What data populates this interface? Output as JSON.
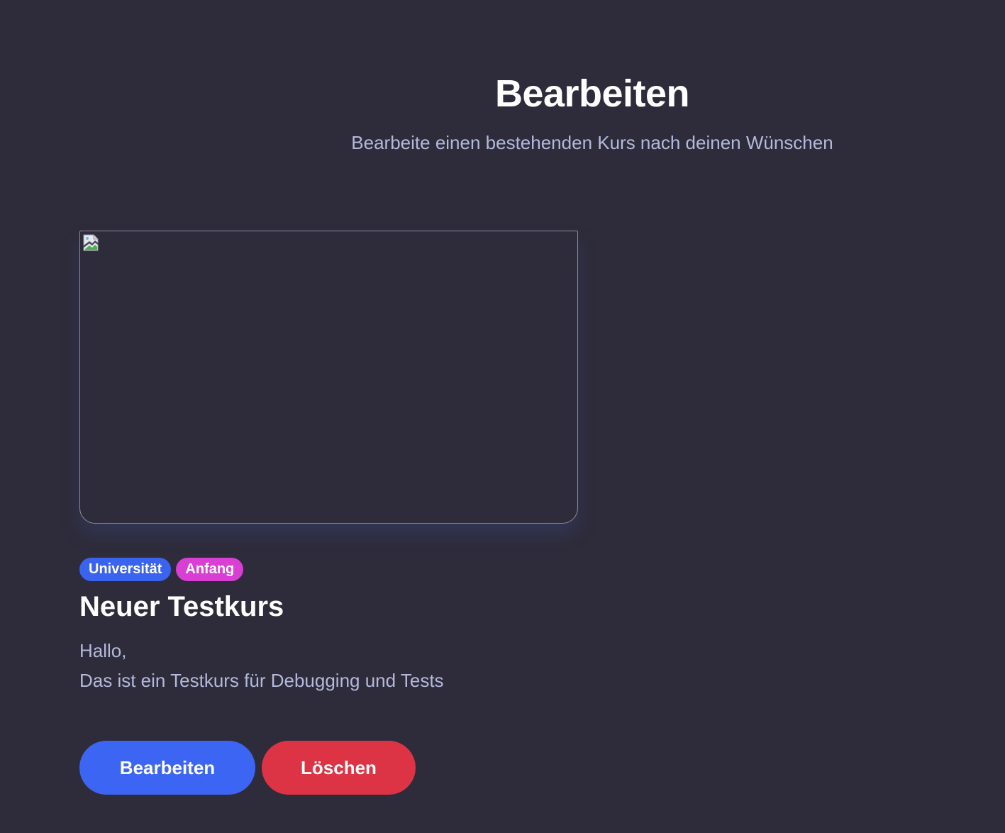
{
  "header": {
    "title": "Bearbeiten",
    "subtitle": "Bearbeite einen bestehenden Kurs nach deinen Wünschen"
  },
  "course": {
    "image_icon": "broken-image-icon",
    "tags": [
      {
        "label": "Universität",
        "color": "#3a63f0"
      },
      {
        "label": "Anfang",
        "color": "#d93fd2"
      }
    ],
    "title": "Neuer Testkurs",
    "description": "Hallo,\nDas ist ein Testkurs für Debugging und Tests",
    "actions": {
      "edit_label": "Bearbeiten",
      "delete_label": "Löschen"
    }
  },
  "colors": {
    "background": "#2e2c3a",
    "primary": "#3b65f2",
    "danger": "#dc3444",
    "muted_text": "#b4b9dc"
  }
}
